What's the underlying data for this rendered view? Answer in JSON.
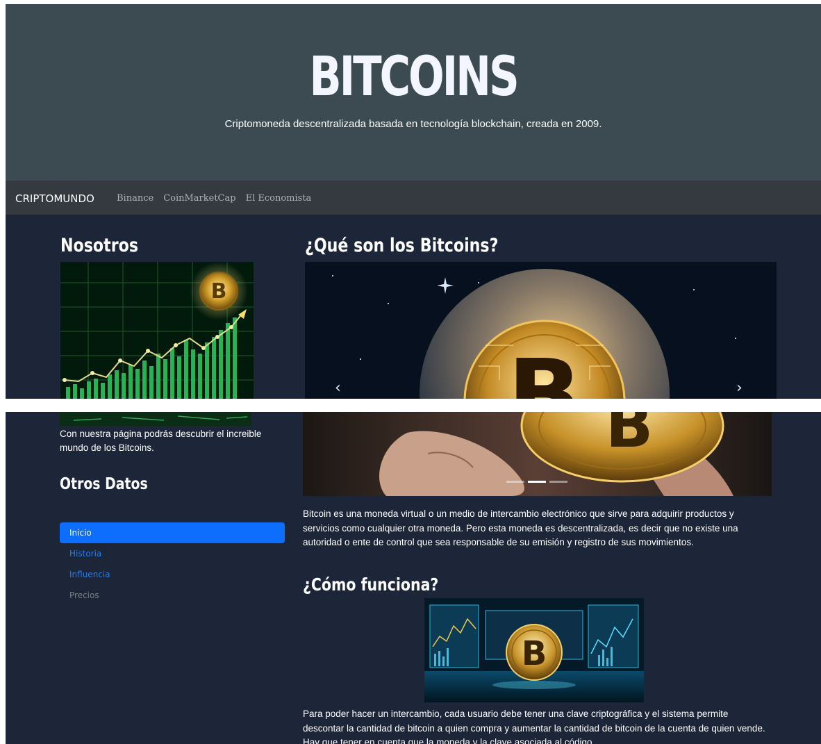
{
  "hero": {
    "title": "BITCOINS",
    "subtitle": "Criptomoneda descentralizada basada en tecnología blockchain, creada en 2009."
  },
  "navbar": {
    "brand": "CRIPTOMUNDO",
    "links": [
      "Binance",
      "CoinMarketCap",
      "El Economista"
    ]
  },
  "nosotros": {
    "title": "Nosotros",
    "text": "Con nuestra página podrás descubrir el increible mundo de los Bitcoins."
  },
  "otros_datos": {
    "title": "Otros Datos",
    "items": [
      "Inicio",
      "Historia",
      "Influencia",
      "Precios"
    ]
  },
  "que_son": {
    "title": "¿Qué son los Bitcoins?",
    "carousel": {
      "prev_icon": "chevron-left-icon",
      "next_icon": "chevron-right-icon",
      "slides": 3,
      "active_slide": 2
    },
    "text": "Bitcoin es una moneda virtual o un medio de intercambio electrónico que sirve para adquirir productos y servicios como cualquier otra moneda. Pero esta moneda es descentralizada, es decir que no existe una autoridad o ente de control que sea responsable de su emisión y registro de sus movimientos."
  },
  "como_funciona": {
    "title": "¿Cómo funciona?",
    "text": "Para poder hacer un intercambio, cada usuario debe tener una clave criptográfica y el sistema permite descontar la cantidad de bitcoin a quien compra y aumentar la cantidad de bitcoin de la cuenta de quien vende. Hay que tener en cuenta que la moneda y la clave asociada al código"
  },
  "colors": {
    "hero_bg": "#3b4b51",
    "navbar_bg": "#343a40",
    "page_bg": "#1d2538",
    "active_item": "#0d6efd",
    "link": "#2a7de8"
  }
}
